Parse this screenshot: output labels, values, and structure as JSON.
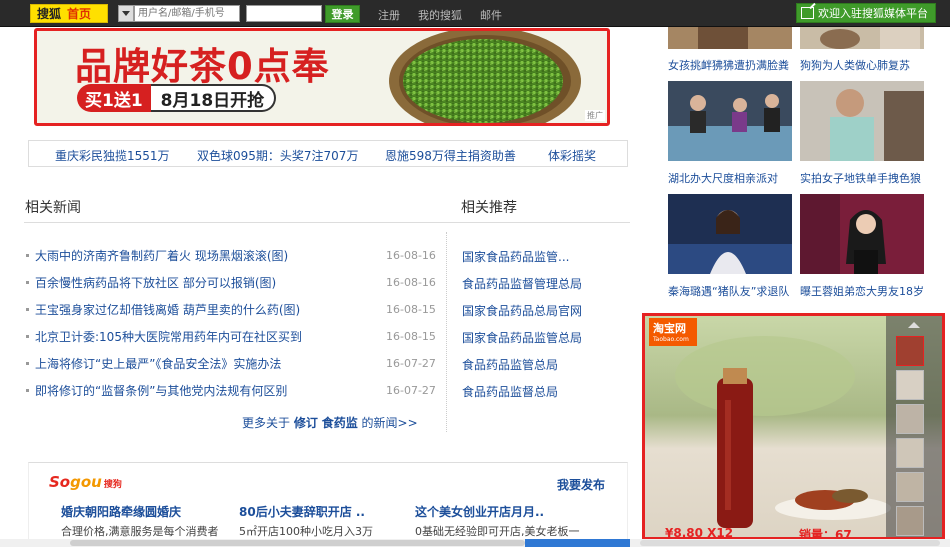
{
  "topbar": {
    "brand": "搜狐",
    "home": "首页",
    "account_placeholder": "用户名/邮箱/手机号",
    "login": "登录",
    "links": [
      "注册",
      "我的搜狐",
      "邮件"
    ],
    "media_platform": "欢迎入驻搜狐媒体平台"
  },
  "banner": {
    "title": "品牌好茶0点奉",
    "promo_a": "买1送1",
    "promo_b": "8月18日开抢",
    "ad_tag": "推广"
  },
  "lottery": [
    "重庆彩民独揽1551万",
    "双色球095期：头奖7注707万",
    "恩施598万得主捐资助善",
    "体彩摇奖"
  ],
  "news": {
    "title": "相关新闻",
    "items": [
      {
        "title": "大雨中的济南齐鲁制药厂着火 现场黑烟滚滚(图)",
        "date": "16-08-16"
      },
      {
        "title": "百余慢性病药品将下放社区 部分可以报销(图)",
        "date": "16-08-16"
      },
      {
        "title": "王宝强身家过亿却借钱离婚 葫芦里卖的什么药(图)",
        "date": "16-08-15"
      },
      {
        "title": "北京卫计委:105种大医院常用药年内可在社区买到",
        "date": "16-08-15"
      },
      {
        "title": "上海将修订“史上最严”《食品安全法》实施办法",
        "date": "16-07-27"
      },
      {
        "title": "即将修订的“监督条例”与其他党内法规有何区别",
        "date": "16-07-27"
      }
    ],
    "more_prefix": "更多关于",
    "more_kw1": "修订",
    "more_kw2": "食药监",
    "more_suffix": "的新闻>>"
  },
  "recommend": {
    "title": "相关推荐",
    "items": [
      "国家食品药品监管...",
      "食品药品监督管理总局",
      "国家食品药品总局官网",
      "国家食品药品监管总局",
      "食品药品监管总局",
      "食品药品监督总局"
    ]
  },
  "sogou": {
    "logo_a": "So",
    "logo_b": "gou",
    "logo_c": "搜狗",
    "publish": "我要发布",
    "ads": [
      {
        "title": "婚庆朝阳路牵缘圆婚庆",
        "desc": "合理价格,满意服务是每个消费者"
      },
      {
        "title": "80后小夫妻辞职开店 ..",
        "desc": "5㎡开店100种小吃月入3万"
      },
      {
        "title": "这个美女创业开店月月..",
        "desc": "0基础无经验即可开店,美女老板一"
      }
    ]
  },
  "right_captions": [
    "女孩挑衅狒狒遭扔满脸粪",
    "狗狗为人类做心肺复苏",
    "湖北办大尺度相亲派对",
    "实拍女子地铁单手拽色狼",
    "秦海璐遇“猪队友”求退队",
    "曝王蓉姐弟恋大男友18岁"
  ],
  "taobao": {
    "logo": "淘宝网",
    "logo_sub": "Taobao.com",
    "price": "¥8.80 X12",
    "sales": "销量：67"
  }
}
